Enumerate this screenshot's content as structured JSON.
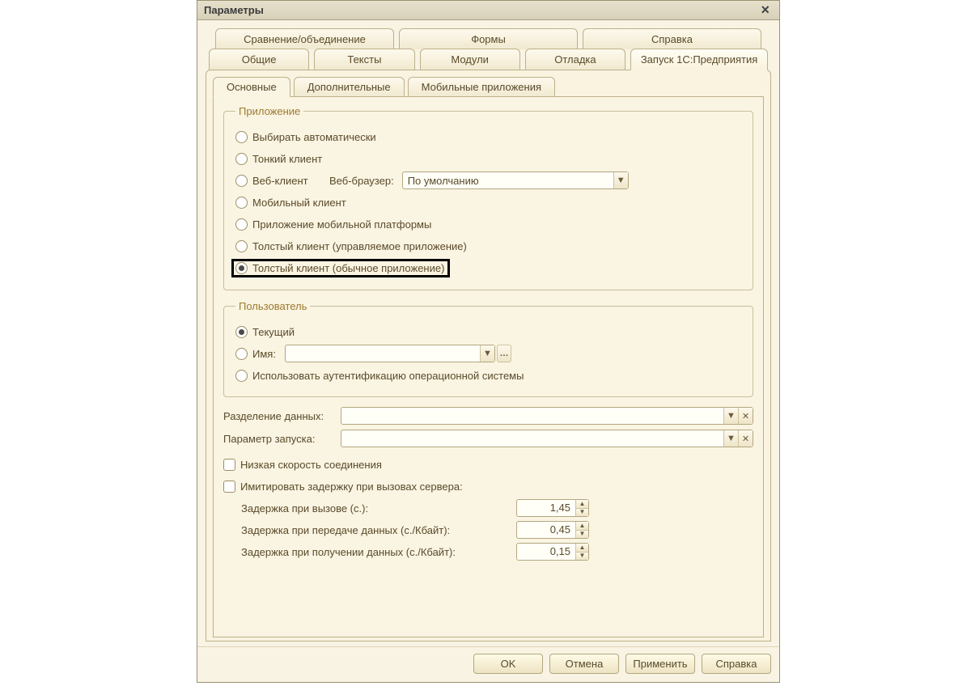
{
  "title": "Параметры",
  "topTabsRow1": [
    "Сравнение/объединение",
    "Формы",
    "Справка"
  ],
  "topTabsRow2": [
    "Общие",
    "Тексты",
    "Модули",
    "Отладка",
    "Запуск 1С:Предприятия"
  ],
  "subTabs": [
    "Основные",
    "Дополнительные",
    "Мобильные приложения"
  ],
  "groupApp": {
    "legend": "Приложение",
    "opts": {
      "auto": "Выбирать автоматически",
      "thin": "Тонкий клиент",
      "web": "Веб-клиент",
      "browserLabel": "Веб-браузер:",
      "browserValue": "По умолчанию",
      "mobile": "Мобильный клиент",
      "mobilePlatform": "Приложение мобильной платформы",
      "thickManaged": "Толстый клиент (управляемое приложение)",
      "thickOrdinary": "Толстый клиент (обычное приложение)"
    }
  },
  "groupUser": {
    "legend": "Пользователь",
    "current": "Текущий",
    "name": "Имя:",
    "osauth": "Использовать аутентификацию операционной системы"
  },
  "fields": {
    "split": "Разделение данных:",
    "launch": "Параметр запуска:"
  },
  "checks": {
    "lowspeed": "Низкая скорость соединения",
    "imitate": "Имитировать задержку при вызовах сервера:"
  },
  "delays": {
    "call": "Задержка при вызове (с.):",
    "send": "Задержка при передаче данных (с./Кбайт):",
    "recv": "Задержка при получении данных (с./Кбайт):",
    "callVal": "1,45",
    "sendVal": "0,45",
    "recvVal": "0,15"
  },
  "buttons": {
    "ok": "OK",
    "cancel": "Отмена",
    "apply": "Применить",
    "help": "Справка"
  }
}
